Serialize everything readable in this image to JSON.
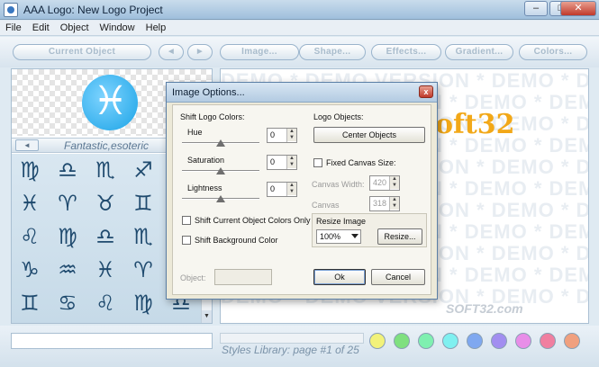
{
  "window": {
    "title": "AAA Logo: New Logo Project",
    "controls": {
      "minimize": "–",
      "maximize": "□",
      "close": "✕"
    }
  },
  "menu": [
    "File",
    "Edit",
    "Object",
    "Window",
    "Help"
  ],
  "toolbar": {
    "current_object": "Current Object",
    "prev": "◄",
    "next": "►",
    "image": "Image...",
    "shape": "Shape...",
    "effects": "Effects...",
    "gradient": "Gradient...",
    "colors": "Colors..."
  },
  "library": {
    "nav_prev": "◄",
    "name": "Fantastic,esoteric",
    "symbols": [
      "♍",
      "♎",
      "♏",
      "♐",
      "♑",
      "♓",
      "♈",
      "♉",
      "♊",
      "♋",
      "♌",
      "♍",
      "♎",
      "♏",
      "♐",
      "♑",
      "♒",
      "♓",
      "♈",
      "♉",
      "♊",
      "♋",
      "♌",
      "♍",
      "♎"
    ],
    "scroll_down": "▼"
  },
  "canvas": {
    "logo_text": "oft32",
    "watermark_row": "DEMO * DEMO VERSION * DEMO * DEMO VERSION * DEMO",
    "site_watermark": "SOFT32.com"
  },
  "status": {
    "library_page": "Styles Library: page #1 of 25",
    "swatches": [
      "#f2f27a",
      "#7fe07f",
      "#7ff0b0",
      "#7ff0f0",
      "#7fa8f0",
      "#a28ef0",
      "#e88ee8",
      "#f07fa0",
      "#f0a07f"
    ]
  },
  "dialog": {
    "title": "Image Options...",
    "close": "x",
    "shift_colors_label": "Shift Logo Colors:",
    "hue": {
      "label": "Hue",
      "value": "0",
      "level": 0.5
    },
    "saturation": {
      "label": "Saturation",
      "value": "0",
      "level": 0.5
    },
    "lightness": {
      "label": "Lightness",
      "value": "0",
      "level": 0.5
    },
    "shift_current_only": "Shift Current Object Colors Only",
    "shift_background": "Shift Background Color",
    "object_label": "Object:",
    "logo_objects_label": "Logo Objects:",
    "center_objects": "Center Objects",
    "fixed_canvas": "Fixed Canvas Size:",
    "canvas_width_label": "Canvas Width:",
    "canvas_width": "420",
    "canvas_height_label": "Canvas",
    "canvas_height": "318",
    "resize_image_label": "Resize Image",
    "resize_value": "100%",
    "resize_button": "Resize...",
    "ok": "Ok",
    "cancel": "Cancel",
    "spin_up": "▲",
    "spin_down": "▼"
  }
}
